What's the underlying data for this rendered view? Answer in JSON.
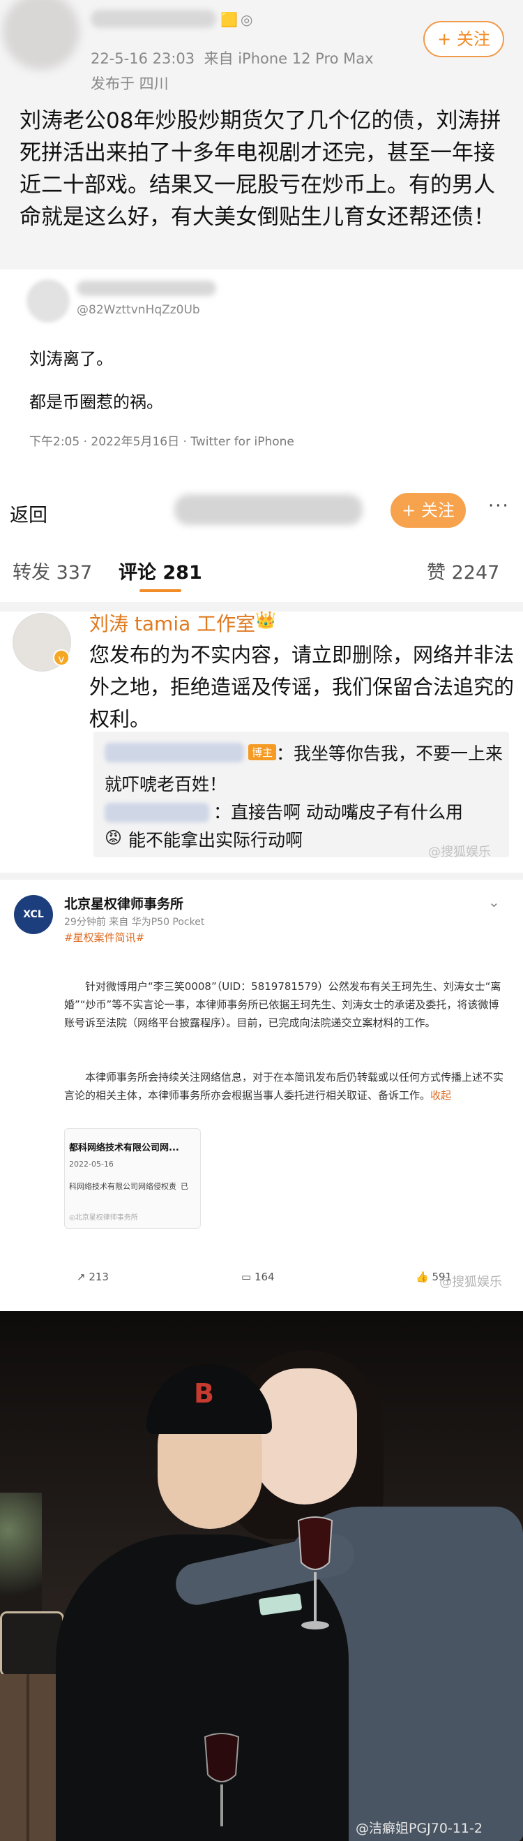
{
  "post": {
    "meta_time": "22-5-16 23:03",
    "meta_source": "来自 iPhone 12 Pro Max",
    "meta_location": "发布于 四川",
    "follow_label": "+ 关注",
    "body": "刘涛老公08年炒股炒期货欠了几个亿的债，刘涛拼死拼活出来拍了十多年电视剧才还完，甚至一年接近二十部戏。结果又一屁股亏在炒币上。有的男人命就是这么好，有大美女倒贴生儿育女还帮还债！"
  },
  "tweet": {
    "handle": "@82WzttvnHqZz0Ub",
    "line1": "刘涛离了。",
    "line2": "都是币圈惹的祸。",
    "meta": "下午2:05 · 2022年5月16日 · Twitter for iPhone"
  },
  "comments": {
    "back_label": "返回",
    "follow_label": "+ 关注",
    "more_label": "···",
    "tabs": {
      "repost": "转发 337",
      "comment": "评论 281",
      "like": "赞 2247"
    },
    "main": {
      "name": "刘涛 tamia 工作室",
      "verified_mark": "v",
      "crown": "👑",
      "text": "您发布的为不实内容，请立即删除，网络并非法外之地，拒绝造谣及传谣，我们保留合法追究的权利。"
    },
    "replies": {
      "tag": "博主",
      "r1_a": "：我坐等你告我，不要一上来",
      "r1_b": "就吓唬老百姓！",
      "r2": "：直接告啊 动动嘴皮子有什么用",
      "emoji": "😡",
      "r3": "能不能拿出实际行动啊"
    },
    "watermark": "@搜狐娱乐"
  },
  "lawfirm": {
    "logo": "XCL",
    "name": "北京星权律师事务所",
    "meta": "29分钟前 来自 华为P50 Pocket",
    "tag": "#星权案件简讯#",
    "chevron": "⌄",
    "para1": "针对微博用户“李三笑0008”（UID：5819781579）公然发布有关王珂先生、刘涛女士“离婚”“炒币”等不实言论一事，本律师事务所已依据王珂先生、刘涛女士的承诺及委托，将该微博账号诉至法院（网络平台披露程序）。目前，已完成向法院递交立案材料的工作。",
    "para2": "本律师事务所会持续关注网络信息，对于在本简讯发布后仍转载或以任何方式传播上述不实言论的相关主体，本律师事务所亦会根据当事人委托进行相关取证、备诉工作。",
    "fold": "收起",
    "card": {
      "title": "都科网络技术有限公司网...",
      "date": "2022-05-16",
      "desc": "科网络技术有限公司网络侵权责",
      "desc_end": "已",
      "foot": "◎北京星权律师事务所"
    },
    "actions": {
      "repost": "↗ 213",
      "comment": "▭ 164",
      "like": "👍 591"
    },
    "watermark": "@搜狐娱乐"
  },
  "photo": {
    "cap_logo": "B",
    "watermark": "@洁癖姐PGJ70-11-2"
  }
}
